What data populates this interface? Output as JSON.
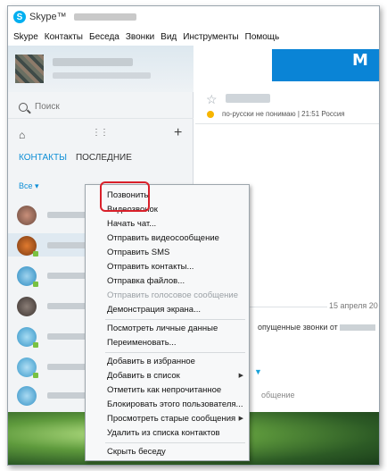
{
  "window": {
    "title": "Skype™"
  },
  "menu": [
    "Skype",
    "Контакты",
    "Беседа",
    "Звонки",
    "Вид",
    "Инструменты",
    "Помощь"
  ],
  "sidebar": {
    "search_placeholder": "Поиск",
    "tabs": [
      {
        "label": "КОНТАКТЫ",
        "active": true
      },
      {
        "label": "ПОСЛЕДНИЕ",
        "active": false
      }
    ],
    "filter_label": "Все ▾"
  },
  "chat": {
    "status_text": "по-русски не понимаю | 21:51 Россия",
    "date": "15 апреля 20",
    "missed_text": "опущенные звонки от",
    "bottom_text": "общение"
  },
  "context_menu": {
    "items": [
      {
        "label": "Позвонить"
      },
      {
        "label": "Видеозвонок"
      },
      {
        "label": "Начать чат..."
      },
      {
        "label": "Отправить видеосообщение"
      },
      {
        "label": "Отправить SMS"
      },
      {
        "label": "Отправить контакты..."
      },
      {
        "label": "Отправка файлов..."
      },
      {
        "label": "Отправить голосовое сообщение",
        "disabled": true
      },
      {
        "label": "Демонстрация экрана..."
      },
      {
        "label": "Посмотреть личные данные"
      },
      {
        "label": "Переименовать..."
      },
      {
        "label": "Добавить в избранное"
      },
      {
        "label": "Добавить в список",
        "submenu": true
      },
      {
        "label": "Отметить как непрочитанное"
      },
      {
        "label": "Блокировать этого пользователя..."
      },
      {
        "label": "Просмотреть старые сообщения",
        "submenu": true
      },
      {
        "label": "Удалить из списка контактов"
      },
      {
        "label": "Скрыть беседу"
      }
    ]
  },
  "colors": {
    "accent": "#0f8fd6",
    "highlight": "#d9202a",
    "online": "#7ac142"
  }
}
